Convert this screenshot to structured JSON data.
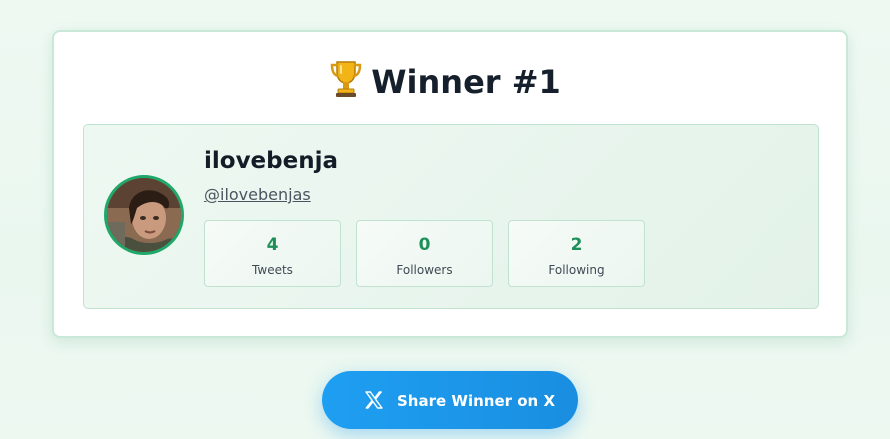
{
  "header": {
    "trophy_icon": "trophy-icon",
    "title": "Winner #1"
  },
  "winner": {
    "display_name": "ilovebenja",
    "handle": "@ilovebenjas",
    "avatar_icon": "user-avatar-photo",
    "stats": [
      {
        "value": "4",
        "label": "Tweets"
      },
      {
        "value": "0",
        "label": "Followers"
      },
      {
        "value": "2",
        "label": "Following"
      }
    ]
  },
  "share": {
    "icon": "x-logo-icon",
    "label": "Share Winner on X"
  },
  "colors": {
    "accent_green": "#1e8f58",
    "avatar_ring": "#1fa86a",
    "share_blue": "#1d9bf0",
    "title_text": "#16202c"
  }
}
